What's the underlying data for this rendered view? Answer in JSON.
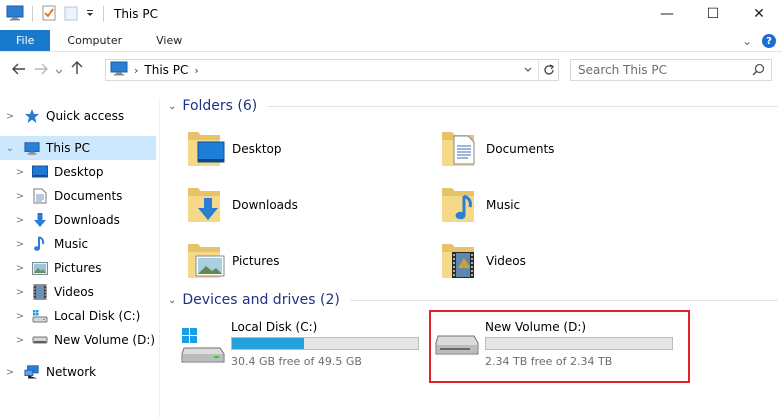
{
  "window": {
    "title": "This PC",
    "controls": {
      "minimize": "—",
      "maximize": "☐",
      "close": "✕"
    }
  },
  "ribbon": {
    "tabs": [
      "File",
      "Computer",
      "View"
    ],
    "expand_glyph": "⌄",
    "help_glyph": "?"
  },
  "address": {
    "crumb": "This PC",
    "search_placeholder": "Search This PC"
  },
  "sidebar": {
    "items": [
      {
        "label": "Quick access",
        "icon": "star-icon"
      },
      {
        "label": "This PC",
        "icon": "computer-icon",
        "selected": true,
        "expanded": true
      },
      {
        "label": "Desktop",
        "icon": "desktop-icon"
      },
      {
        "label": "Documents",
        "icon": "documents-icon"
      },
      {
        "label": "Downloads",
        "icon": "downloads-icon"
      },
      {
        "label": "Music",
        "icon": "music-icon"
      },
      {
        "label": "Pictures",
        "icon": "pictures-icon"
      },
      {
        "label": "Videos",
        "icon": "videos-icon"
      },
      {
        "label": "Local Disk (C:)",
        "icon": "drive-c-icon"
      },
      {
        "label": "New Volume (D:)",
        "icon": "drive-icon"
      },
      {
        "label": "Network",
        "icon": "network-icon"
      }
    ]
  },
  "content": {
    "folders_header": "Folders (6)",
    "folders": [
      {
        "label": "Desktop",
        "icon": "desktop-folder-icon"
      },
      {
        "label": "Documents",
        "icon": "documents-folder-icon"
      },
      {
        "label": "Downloads",
        "icon": "downloads-folder-icon"
      },
      {
        "label": "Music",
        "icon": "music-folder-icon"
      },
      {
        "label": "Pictures",
        "icon": "pictures-folder-icon"
      },
      {
        "label": "Videos",
        "icon": "videos-folder-icon"
      }
    ],
    "drives_header": "Devices and drives (2)",
    "drives": [
      {
        "label": "Local Disk (C:)",
        "free": "30.4 GB free of 49.5 GB",
        "used_fraction": 0.386
      },
      {
        "label": "New Volume (D:)",
        "free": "2.34 TB free of 2.34 TB",
        "used_fraction": 0.0
      }
    ]
  },
  "colors": {
    "accent": "#1979ca",
    "selection": "#cce8ff",
    "group_header": "#1e3287",
    "usage_bar": "#26a0da",
    "highlight": "#e0202a"
  }
}
